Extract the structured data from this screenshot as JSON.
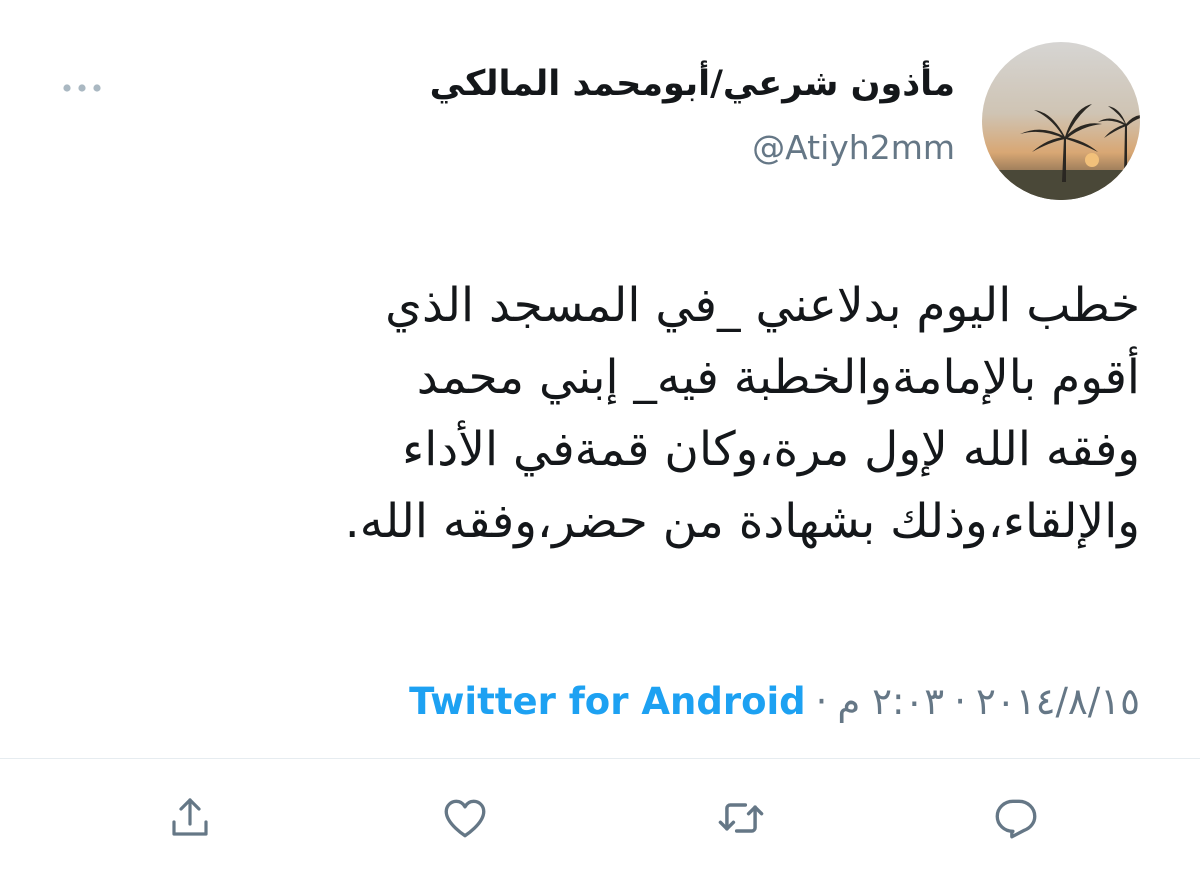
{
  "tweet": {
    "display_name": "مأذون شرعي/أبومحمد المالكي",
    "handle": "@Atiyh2mm",
    "text_lines": [
      "خطب اليوم بدلاعني _في المسجد الذي",
      "أقوم بالإمامةوالخطبة فيه_ إبني محمد",
      "وفقه الله لإول مرة،وكان قمةفي الأداء",
      "والإلقاء،وذلك بشهادة من حضر،وفقه الله."
    ],
    "date": "٢٠١٤/٨/١٥",
    "time": "٢:٠٣ م",
    "separator": "·",
    "source": "Twitter for Android"
  },
  "icons": {
    "more": "more-horizontal-icon",
    "share": "share-icon",
    "like": "heart-icon",
    "retweet": "retweet-icon",
    "reply": "reply-icon"
  },
  "colors": {
    "text": "#14171a",
    "secondary": "#657786",
    "accent": "#1da1f2",
    "icon": "#657786",
    "divider": "#e6ecf0"
  }
}
